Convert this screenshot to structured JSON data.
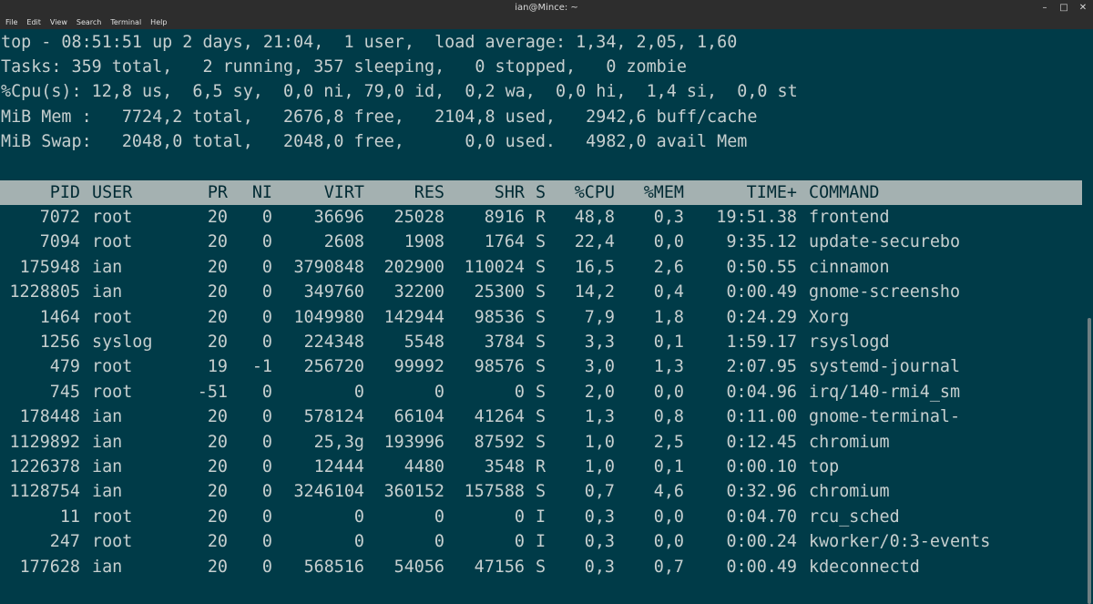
{
  "window": {
    "title": "ian@Mince: ~",
    "controls": [
      "–",
      "□",
      "✕"
    ]
  },
  "menu": [
    "File",
    "Edit",
    "View",
    "Search",
    "Terminal",
    "Help"
  ],
  "summary": [
    "top - 08:51:51 up 2 days, 21:04,  1 user,  load average: 1,34, 2,05, 1,60",
    "Tasks: 359 total,   2 running, 357 sleeping,   0 stopped,   0 zombie",
    "%Cpu(s): 12,8 us,  6,5 sy,  0,0 ni, 79,0 id,  0,2 wa,  0,0 hi,  1,4 si,  0,0 st",
    "MiB Mem :   7724,2 total,   2676,8 free,   2104,8 used,   2942,6 buff/cache",
    "MiB Swap:   2048,0 total,   2048,0 free,      0,0 used.   4982,0 avail Mem"
  ],
  "columns": [
    "PID",
    "USER",
    "PR",
    "NI",
    "VIRT",
    "RES",
    "SHR",
    "S",
    "%CPU",
    "%MEM",
    "TIME+",
    "COMMAND"
  ],
  "processes": [
    [
      "7072",
      "root",
      "20",
      "0",
      "36696",
      "25028",
      "8916",
      "R",
      "48,8",
      "0,3",
      "19:51.38",
      "frontend"
    ],
    [
      "7094",
      "root",
      "20",
      "0",
      "2608",
      "1908",
      "1764",
      "S",
      "22,4",
      "0,0",
      "9:35.12",
      "update-securebo"
    ],
    [
      "175948",
      "ian",
      "20",
      "0",
      "3790848",
      "202900",
      "110024",
      "S",
      "16,5",
      "2,6",
      "0:50.55",
      "cinnamon"
    ],
    [
      "1228805",
      "ian",
      "20",
      "0",
      "349760",
      "32200",
      "25300",
      "S",
      "14,2",
      "0,4",
      "0:00.49",
      "gnome-screensho"
    ],
    [
      "1464",
      "root",
      "20",
      "0",
      "1049980",
      "142944",
      "98536",
      "S",
      "7,9",
      "1,8",
      "0:24.29",
      "Xorg"
    ],
    [
      "1256",
      "syslog",
      "20",
      "0",
      "224348",
      "5548",
      "3784",
      "S",
      "3,3",
      "0,1",
      "1:59.17",
      "rsyslogd"
    ],
    [
      "479",
      "root",
      "19",
      "-1",
      "256720",
      "99992",
      "98576",
      "S",
      "3,0",
      "1,3",
      "2:07.95",
      "systemd-journal"
    ],
    [
      "745",
      "root",
      "-51",
      "0",
      "0",
      "0",
      "0",
      "S",
      "2,0",
      "0,0",
      "0:04.96",
      "irq/140-rmi4_sm"
    ],
    [
      "178448",
      "ian",
      "20",
      "0",
      "578124",
      "66104",
      "41264",
      "S",
      "1,3",
      "0,8",
      "0:11.00",
      "gnome-terminal-"
    ],
    [
      "1129892",
      "ian",
      "20",
      "0",
      "25,3g",
      "193996",
      "87592",
      "S",
      "1,0",
      "2,5",
      "0:12.45",
      "chromium"
    ],
    [
      "1226378",
      "ian",
      "20",
      "0",
      "12444",
      "4480",
      "3548",
      "R",
      "1,0",
      "0,1",
      "0:00.10",
      "top"
    ],
    [
      "1128754",
      "ian",
      "20",
      "0",
      "3246104",
      "360152",
      "157588",
      "S",
      "0,7",
      "4,6",
      "0:32.96",
      "chromium"
    ],
    [
      "11",
      "root",
      "20",
      "0",
      "0",
      "0",
      "0",
      "I",
      "0,3",
      "0,0",
      "0:04.70",
      "rcu_sched"
    ],
    [
      "247",
      "root",
      "20",
      "0",
      "0",
      "0",
      "0",
      "I",
      "0,3",
      "0,0",
      "0:00.24",
      "kworker/0:3-events"
    ],
    [
      "177628",
      "ian",
      "20",
      "0",
      "568516",
      "54056",
      "47156",
      "S",
      "0,3",
      "0,7",
      "0:00.49",
      "kdeconnectd"
    ]
  ]
}
